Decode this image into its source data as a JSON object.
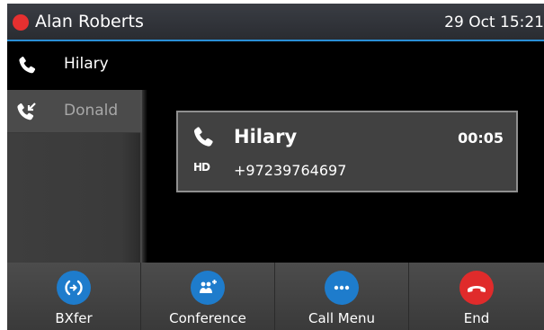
{
  "header": {
    "user_name": "Alan Roberts",
    "datetime": "29 Oct 15:21",
    "status_color": "#e63030",
    "accent_color": "#2a8fd6"
  },
  "call_list": [
    {
      "name": "Hilary",
      "state": "active",
      "icon": "phone-icon"
    },
    {
      "name": "Donald",
      "state": "held",
      "icon": "incoming-call-icon"
    }
  ],
  "active_call": {
    "name": "Hilary",
    "number": "+97239764697",
    "duration": "00:05",
    "hd_label": "HD"
  },
  "softkeys": [
    {
      "label": "BXfer",
      "icon": "blind-transfer-icon",
      "color": "#1e7ccc"
    },
    {
      "label": "Conference",
      "icon": "conference-icon",
      "color": "#1e7ccc"
    },
    {
      "label": "Call Menu",
      "icon": "more-icon",
      "color": "#1e7ccc"
    },
    {
      "label": "End",
      "icon": "end-call-icon",
      "color": "#e02b2b"
    }
  ]
}
